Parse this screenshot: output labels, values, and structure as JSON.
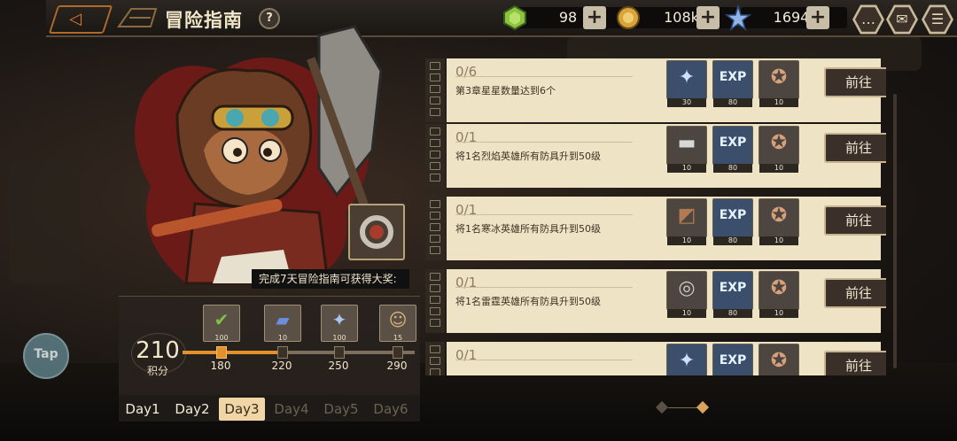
{
  "header": {
    "title": "冒险指南",
    "help_label": "?"
  },
  "resources": [
    {
      "name": "green-gem",
      "value": "98",
      "color": "#8bc53f"
    },
    {
      "name": "gold-coin",
      "value": "108k",
      "color": "#d9a43a"
    },
    {
      "name": "crystal-star",
      "value": "1694",
      "color": "#8fb4e8"
    }
  ],
  "grand_reward": {
    "caption": "完成7天冒险指南可获得大奖:"
  },
  "score": {
    "value": "210",
    "label": "积分",
    "progress": 0.45
  },
  "milestones": [
    {
      "threshold": "180",
      "item": "check-box",
      "count": "100",
      "reached": true
    },
    {
      "threshold": "220",
      "item": "blue-card",
      "count": "10",
      "reached": false
    },
    {
      "threshold": "250",
      "item": "crystal-star",
      "count": "100",
      "reached": false
    },
    {
      "threshold": "290",
      "item": "hero-portrait",
      "count": "15",
      "reached": false
    }
  ],
  "day_tabs": [
    {
      "label": "Day1",
      "state": "normal"
    },
    {
      "label": "Day2",
      "state": "normal"
    },
    {
      "label": "Day3",
      "state": "active"
    },
    {
      "label": "Day4",
      "state": "locked"
    },
    {
      "label": "Day5",
      "state": "locked"
    },
    {
      "label": "Day6",
      "state": "locked"
    }
  ],
  "tasks": [
    {
      "progress": "0/6",
      "description": "第3章星星数量达到6个",
      "button": "前往",
      "rewards": [
        {
          "item": "crystal-star",
          "count": "30"
        },
        {
          "item": "exp",
          "count": "80",
          "label": "EXP"
        },
        {
          "item": "medal",
          "count": "10"
        }
      ]
    },
    {
      "progress": "0/1",
      "description": "将1名烈焰英雄所有防具升到50级",
      "button": "前往",
      "rewards": [
        {
          "item": "iron-ingot",
          "count": "10"
        },
        {
          "item": "exp",
          "count": "80",
          "label": "EXP"
        },
        {
          "item": "medal",
          "count": "10"
        }
      ]
    },
    {
      "progress": "0/1",
      "description": "将1名寒冰英雄所有防具升到50级",
      "button": "前往",
      "rewards": [
        {
          "item": "leather",
          "count": "10"
        },
        {
          "item": "exp",
          "count": "80",
          "label": "EXP"
        },
        {
          "item": "medal",
          "count": "10"
        }
      ]
    },
    {
      "progress": "0/1",
      "description": "将1名雷霆英雄所有防具升到50级",
      "button": "前往",
      "rewards": [
        {
          "item": "coin-stack",
          "count": "10"
        },
        {
          "item": "exp",
          "count": "80",
          "label": "EXP"
        },
        {
          "item": "medal",
          "count": "10"
        }
      ]
    },
    {
      "progress": "0/1",
      "description": "",
      "button": "前往",
      "rewards": [
        {
          "item": "crystal-star",
          "count": ""
        },
        {
          "item": "exp",
          "count": "",
          "label": "EXP"
        },
        {
          "item": "medal",
          "count": ""
        }
      ]
    }
  ],
  "tap_button": {
    "label": "Tap"
  },
  "top_menu": [
    {
      "name": "chat-icon",
      "glyph": "…"
    },
    {
      "name": "mail-icon",
      "glyph": "✉"
    },
    {
      "name": "menu-icon",
      "glyph": "☰"
    }
  ]
}
